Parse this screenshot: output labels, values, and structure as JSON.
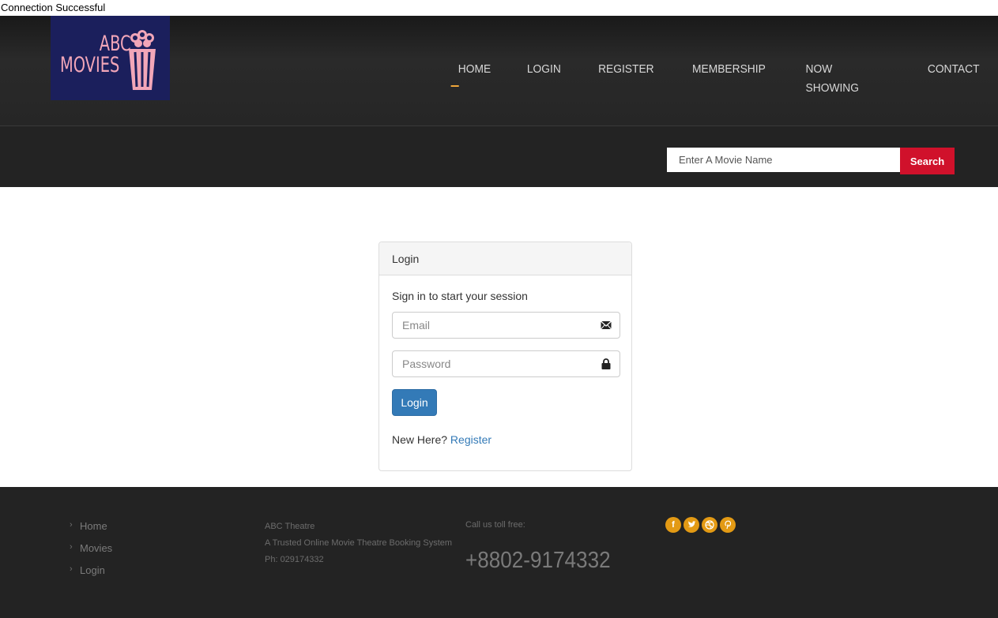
{
  "status_message": "Connection Successful",
  "logo": {
    "line1": "ABC",
    "line2": "MOVIES"
  },
  "nav": {
    "items": [
      "HOME",
      "LOGIN",
      "REGISTER",
      "MEMBERSHIP",
      "NOW SHOWING",
      "CONTACT"
    ],
    "active": "HOME"
  },
  "search": {
    "placeholder": "Enter A Movie Name",
    "button_label": "Search"
  },
  "login_panel": {
    "heading": "Login",
    "subtitle": "Sign in to start your session",
    "email_placeholder": "Email",
    "password_placeholder": "Password",
    "submit_label": "Login",
    "new_here_text": "New Here?",
    "register_link": "Register"
  },
  "footer": {
    "links": [
      "Home",
      "Movies",
      "Login"
    ],
    "about": {
      "name": "ABC Theatre",
      "tagline": "A Trusted Online Movie Theatre Booking System",
      "phone": "Ph: 029174332"
    },
    "call_label": "Call us toll free:",
    "toll_free": "+8802-9174332",
    "social_icons": [
      "facebook-icon",
      "twitter-icon",
      "dribbble-icon",
      "pinterest-icon"
    ]
  },
  "colors": {
    "header_bg": "#232323",
    "accent_orange": "#f0a63a",
    "search_button": "#d0112b",
    "login_button": "#337ab7",
    "social_bg": "#e39a14",
    "logo_bg": "#1b1f5c",
    "logo_text": "#f2a6b8"
  }
}
